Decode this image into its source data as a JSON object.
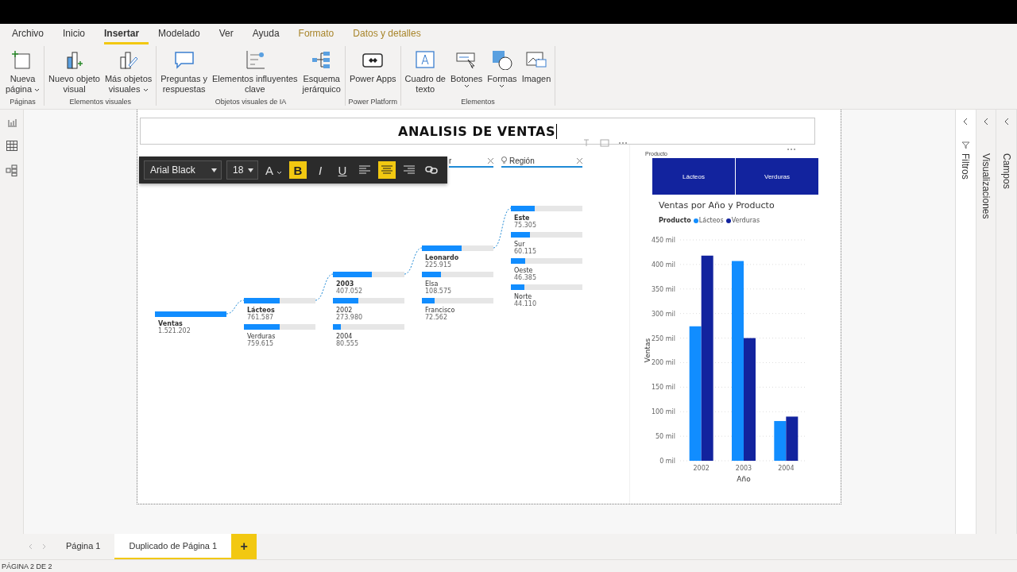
{
  "menu_tabs": [
    {
      "label": "Archivo",
      "selected": false,
      "kind": "normal"
    },
    {
      "label": "Inicio",
      "selected": false,
      "kind": "normal"
    },
    {
      "label": "Insertar",
      "selected": true,
      "kind": "normal"
    },
    {
      "label": "Modelado",
      "selected": false,
      "kind": "normal"
    },
    {
      "label": "Ver",
      "selected": false,
      "kind": "normal"
    },
    {
      "label": "Ayuda",
      "selected": false,
      "kind": "normal"
    },
    {
      "label": "Formato",
      "selected": false,
      "kind": "contextual"
    },
    {
      "label": "Datos y detalles",
      "selected": false,
      "kind": "contextual"
    }
  ],
  "ribbon_groups": [
    {
      "label": "Páginas",
      "items": [
        {
          "lines": [
            "Nueva",
            "página"
          ],
          "caret": true
        }
      ]
    },
    {
      "label": "Elementos visuales",
      "items": [
        {
          "lines": [
            "Nuevo objeto",
            "visual"
          ],
          "caret": false
        },
        {
          "lines": [
            "Más objetos",
            "visuales"
          ],
          "caret": true
        }
      ]
    },
    {
      "label": "Objetos visuales de IA",
      "items": [
        {
          "lines": [
            "Preguntas y",
            "respuestas"
          ],
          "caret": false
        },
        {
          "lines": [
            "Elementos influyentes",
            "clave"
          ],
          "caret": false
        },
        {
          "lines": [
            "Esquema",
            "jerárquico"
          ],
          "caret": false
        }
      ]
    },
    {
      "label": "Power Platform",
      "items": [
        {
          "lines": [
            "Power Apps"
          ],
          "caret": false
        }
      ]
    },
    {
      "label": "Elementos",
      "items": [
        {
          "lines": [
            "Cuadro de",
            "texto"
          ],
          "caret": false
        },
        {
          "lines": [
            "Botones"
          ],
          "caret": true
        },
        {
          "lines": [
            "Formas"
          ],
          "caret": true
        },
        {
          "lines": [
            "Imagen"
          ],
          "caret": false
        }
      ]
    }
  ],
  "report_title": "ANALISIS DE VENTAS",
  "format_toolbar": {
    "font": "Arial Black",
    "size": "18",
    "buttons": [
      {
        "kind": "color",
        "label": "A",
        "on": false
      },
      {
        "kind": "bold",
        "label": "B",
        "on": true
      },
      {
        "kind": "italic",
        "label": "I",
        "on": false
      },
      {
        "kind": "underline",
        "label": "U",
        "on": false
      },
      {
        "kind": "align-left",
        "on": false
      },
      {
        "kind": "align-center",
        "on": true
      },
      {
        "kind": "align-right",
        "on": false
      },
      {
        "kind": "link",
        "on": false
      }
    ]
  },
  "decomposition_tree": {
    "headers": [
      {
        "label": "r",
        "bulb": false
      },
      {
        "label": "Región",
        "bulb": true
      }
    ],
    "columns": [
      [
        {
          "label": "Ventas",
          "value": "1.521.202",
          "level": 1,
          "selected": true
        }
      ],
      [
        {
          "label": "Lácteos",
          "value": "761.587",
          "level": 0.5,
          "selected": true
        },
        {
          "label": "Verduras",
          "value": "759.615",
          "level": 0.5,
          "selected": false
        }
      ],
      [
        {
          "label": "2003",
          "value": "407.052",
          "level": 0.54,
          "selected": true
        },
        {
          "label": "2002",
          "value": "273.980",
          "level": 0.36,
          "selected": false
        },
        {
          "label": "2004",
          "value": "80.555",
          "level": 0.11,
          "selected": false
        }
      ],
      [
        {
          "label": "Leonardo",
          "value": "225.915",
          "level": 0.56,
          "selected": true
        },
        {
          "label": "Elsa",
          "value": "108.575",
          "level": 0.27,
          "selected": false
        },
        {
          "label": "Francisco",
          "value": "72.562",
          "level": 0.18,
          "selected": false
        }
      ],
      [
        {
          "label": "Este",
          "value": "75.305",
          "level": 0.33,
          "selected": true
        },
        {
          "label": "Sur",
          "value": "60.115",
          "level": 0.27,
          "selected": false
        },
        {
          "label": "Oeste",
          "value": "46.385",
          "level": 0.2,
          "selected": false
        },
        {
          "label": "Norte",
          "value": "44.110",
          "level": 0.19,
          "selected": false
        }
      ]
    ]
  },
  "slicer": {
    "title": "Producto",
    "options": [
      "Lácteos",
      "Verduras"
    ]
  },
  "chart": {
    "chart_data": {
      "type": "bar",
      "title": "Ventas por Año y Producto",
      "xlabel": "Año",
      "ylabel": "Ventas",
      "categories": [
        "2002",
        "2003",
        "2004"
      ],
      "legend_title": "Producto",
      "legend": "top",
      "grid": true,
      "series": [
        {
          "name": "Lácteos",
          "color": "#118dff",
          "values": [
            274,
            407,
            81
          ]
        },
        {
          "name": "Verduras",
          "color": "#12239e",
          "values": [
            418,
            250,
            90
          ]
        }
      ],
      "ylim": [
        0,
        450
      ],
      "yticks": [
        {
          "value": 0,
          "label": "0 mil"
        },
        {
          "value": 50,
          "label": "50 mil"
        },
        {
          "value": 100,
          "label": "100 mil"
        },
        {
          "value": 150,
          "label": "150 mil"
        },
        {
          "value": 200,
          "label": "200 mil"
        },
        {
          "value": 250,
          "label": "250 mil"
        },
        {
          "value": 300,
          "label": "300 mil"
        },
        {
          "value": 350,
          "label": "350 mil"
        },
        {
          "value": 400,
          "label": "400 mil"
        },
        {
          "value": 450,
          "label": "450 mil"
        }
      ]
    }
  },
  "side_panes": [
    "Filtros",
    "Visualizaciones",
    "Campos"
  ],
  "page_tabs": [
    {
      "label": "Página 1",
      "selected": false
    },
    {
      "label": "Duplicado de Página 1",
      "selected": true
    }
  ],
  "add_page": "+",
  "status_bar": "PÁGINA 2 DE 2"
}
